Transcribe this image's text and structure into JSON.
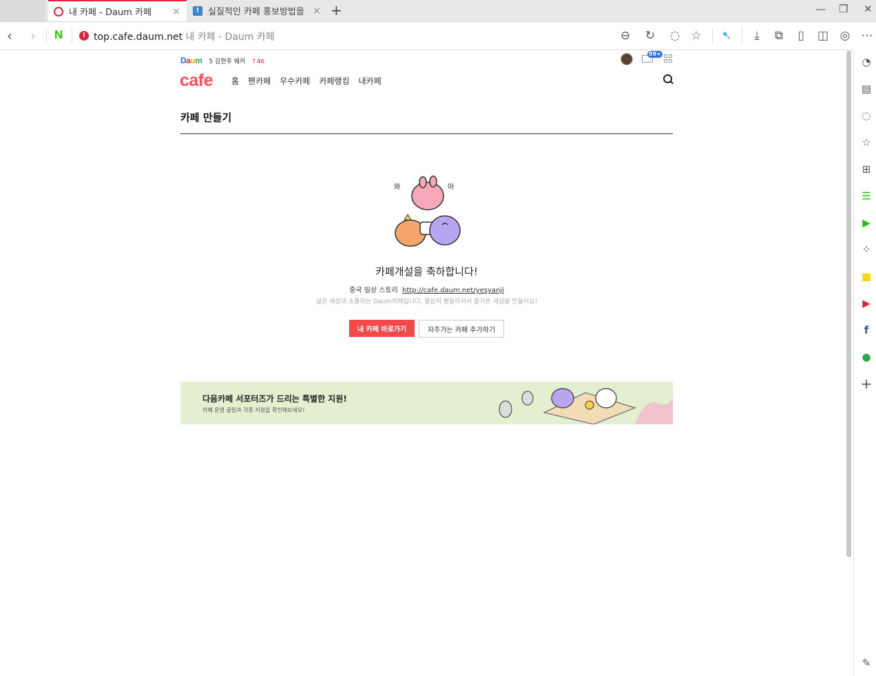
{
  "browser": {
    "tabs": [
      {
        "title": "내 카페 - Daum 카페",
        "active": true,
        "favicon": "daum-favicon"
      },
      {
        "title": "실질적인 카페 홍보방법을",
        "active": false,
        "favicon": "blog-favicon"
      }
    ],
    "url_host": "top.cafe.daum.net",
    "url_page_title": "내 카페 - Daum 카페",
    "n_button": "N",
    "accent_color": "#e0243a"
  },
  "header": {
    "ticker_rank": "5",
    "ticker_text": "김현주 웨커",
    "ticker_change": "↑46",
    "mail_badge": "99+",
    "logo": "cafe",
    "logo_color": "#ff4d5a",
    "nav": [
      "홈",
      "팬카페",
      "우수카페",
      "카페랭킹",
      "내카페"
    ]
  },
  "main": {
    "page_title": "카페 만들기",
    "illustration_text_left": "와",
    "illustration_text_right": "아",
    "congrats": "카페개설을 축하합니다!",
    "cafe_name": "중국 일상 스토리",
    "cafe_url": "http://cafe.daum.net/yesyanji",
    "description": "넓은 세상과 소통하는 Daum카페입니다. 열심히 활동하셔서 즐거운 세상을 만들어요!",
    "primary_button": "내 카페 바로가기",
    "secondary_button": "자주가는 카페 추가하기",
    "primary_color": "#f24a4a"
  },
  "banner": {
    "title": "다음카페 서포터즈가 드리는 특별한 지원!",
    "subtitle": "카페 운영 꿀팁과 각종 지원을 확인해보세요!",
    "background": "#e3efcf"
  }
}
